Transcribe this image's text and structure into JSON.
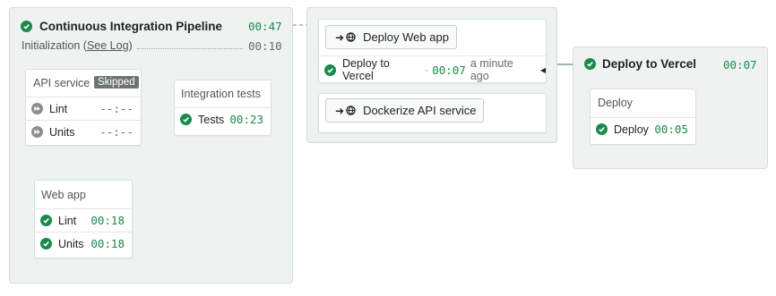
{
  "pipeline": {
    "title": "Continuous Integration Pipeline",
    "duration": "00:47",
    "init_label": "Initialization (",
    "see_log": "See Log",
    "init_close": ")",
    "init_duration": "00:10"
  },
  "api_service": {
    "title": "API service",
    "badge": "Skipped",
    "jobs": [
      {
        "name": "Lint",
        "time": "--:--"
      },
      {
        "name": "Units",
        "time": "--:--"
      }
    ]
  },
  "integration_tests": {
    "title": "Integration tests",
    "jobs": [
      {
        "name": "Tests",
        "time": "00:23"
      }
    ]
  },
  "web_app": {
    "title": "Web app",
    "jobs": [
      {
        "name": "Lint",
        "time": "00:18"
      },
      {
        "name": "Units",
        "time": "00:18"
      }
    ]
  },
  "promotions": {
    "deploy_web_app": "Deploy Web app",
    "deploy_status_name": "Deploy to Vercel",
    "deploy_status_sep": "·",
    "deploy_status_time": "00:07",
    "deploy_status_when": "a minute ago",
    "dockerize": "Dockerize API service"
  },
  "deploy_pipeline": {
    "title": "Deploy to Vercel",
    "duration": "00:07",
    "block_title": "Deploy",
    "jobs": [
      {
        "name": "Deploy",
        "time": "00:05"
      }
    ]
  },
  "icons": {
    "passed": "check-circle-icon",
    "skipped": "fast-forward-circle-icon",
    "promote": "arrow-right-icon",
    "deploy": "globe-icon",
    "selected": "triangle-left-icon"
  },
  "colors": {
    "passed_green": "#1a8a4c",
    "skipped_grey": "#6e7473",
    "panel_bg": "#eef2f1",
    "connector": "#9fb0ad"
  }
}
